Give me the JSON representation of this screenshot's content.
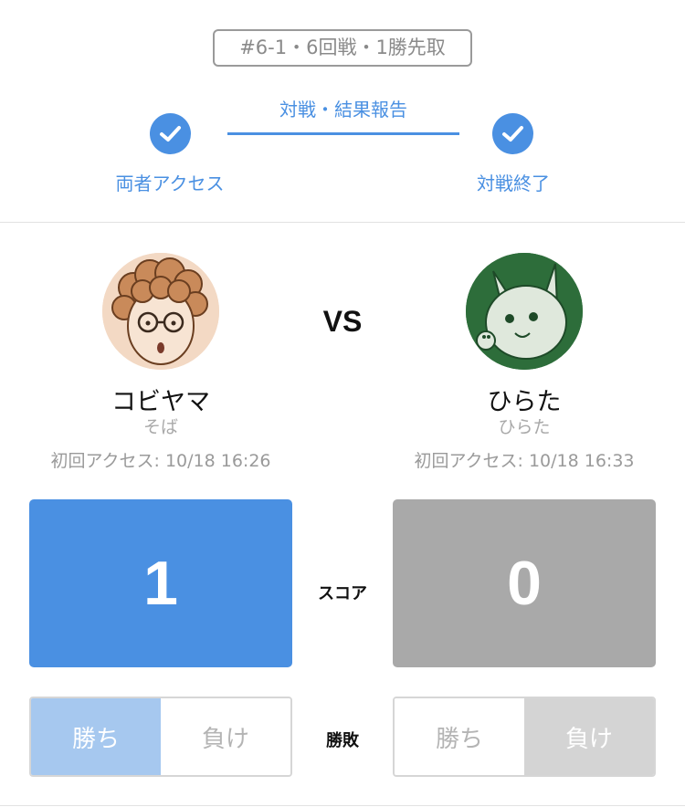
{
  "match": {
    "tag": "#6-1・6回戦・1勝先取"
  },
  "progress": {
    "step_left": "両者アクセス",
    "step_middle": "対戦・結果報告",
    "step_right": "対戦終了",
    "steps_completed": 2
  },
  "vs_label": "VS",
  "players": [
    {
      "name": "コビヤマ",
      "sub": "そば",
      "first_access": "初回アクセス: 10/18 16:26",
      "score": "1",
      "result": "win"
    },
    {
      "name": "ひらた",
      "sub": "ひらた",
      "first_access": "初回アクセス: 10/18 16:33",
      "score": "0",
      "result": "lose"
    }
  ],
  "score_label": "スコア",
  "result_label": "勝敗",
  "win_label": "勝ち",
  "lose_label": "負け",
  "colors": {
    "accent": "#4a90e2",
    "score_loser": "#a9a9a9",
    "win_active": "#a6c8ef",
    "lose_active": "#d4d4d4"
  }
}
